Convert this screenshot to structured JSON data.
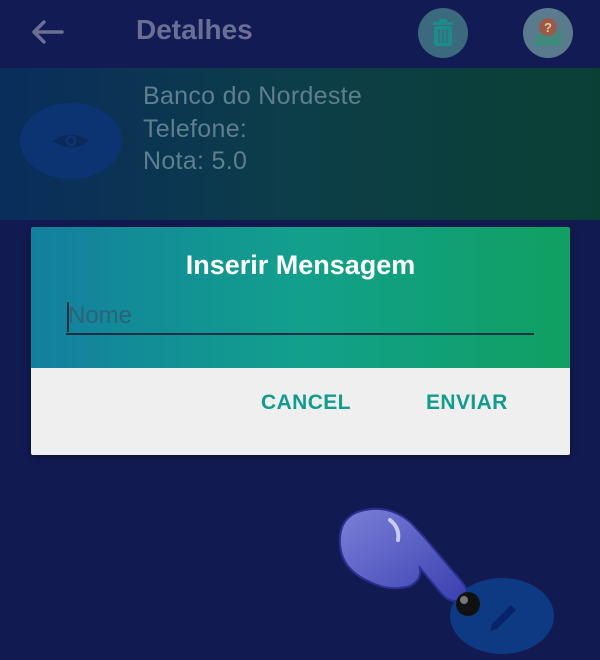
{
  "appbar": {
    "title": "Detalhes",
    "back_icon": "arrow-left-icon",
    "trash_icon": "trash-icon",
    "help_icon": "help-map-icon"
  },
  "business": {
    "name": "Banco do Nordeste",
    "phone_label": "Telefone:",
    "rating_label": "Nota: 5.0",
    "view_icon": "eye-icon"
  },
  "dialog": {
    "title": "Inserir Mensagem",
    "input_placeholder": "Nome",
    "input_value": "",
    "cancel_label": "CANCEL",
    "send_label": "ENVIAR"
  },
  "fab": {
    "icon": "pencil-icon"
  },
  "overlay": {
    "icon": "pointing-hand-icon"
  }
}
